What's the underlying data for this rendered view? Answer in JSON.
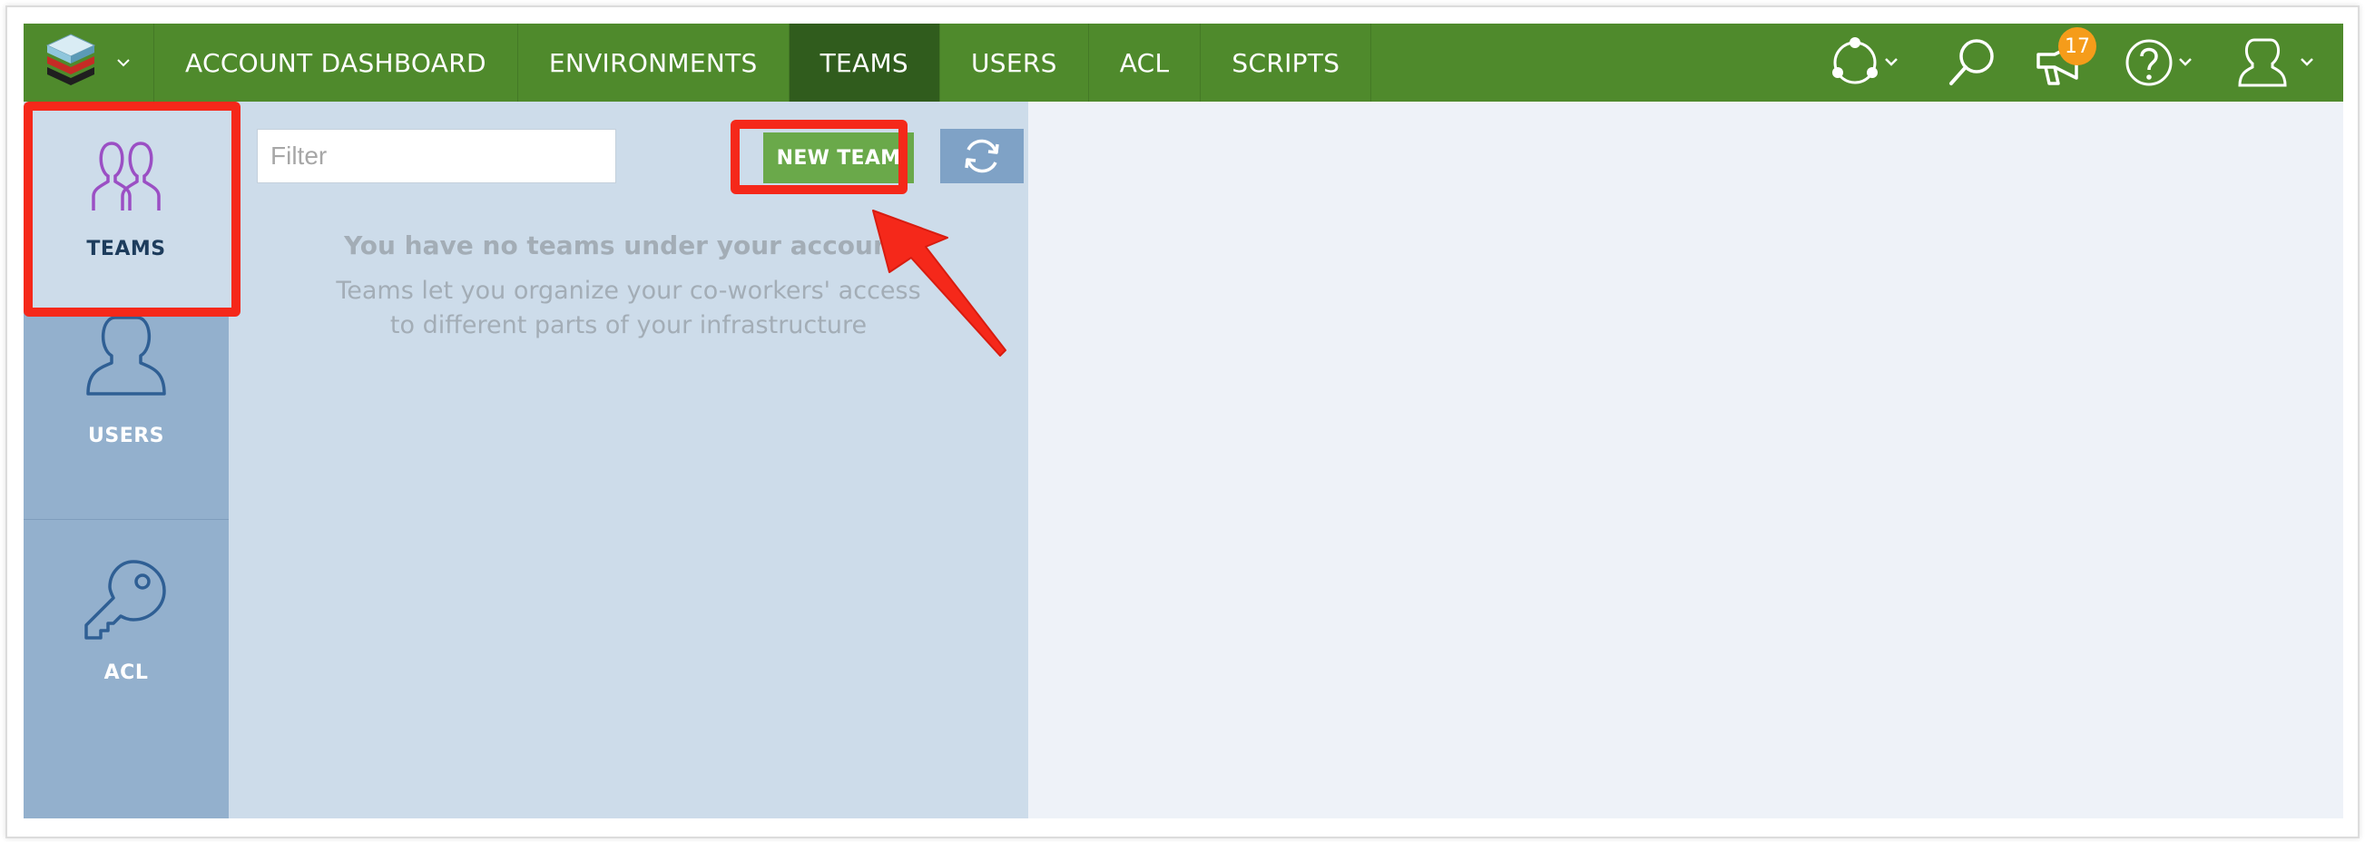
{
  "topbar": {
    "logo_icon": "stack-logo-icon",
    "nav": [
      {
        "label": "ACCOUNT DASHBOARD",
        "active": false
      },
      {
        "label": "ENVIRONMENTS",
        "active": false
      },
      {
        "label": "TEAMS",
        "active": true
      },
      {
        "label": "USERS",
        "active": false
      },
      {
        "label": "ACL",
        "active": false
      },
      {
        "label": "SCRIPTS",
        "active": false
      }
    ],
    "right_icons": [
      "network-icon",
      "search-icon",
      "announcements-icon",
      "help-icon",
      "user-icon"
    ],
    "notification_count": "17",
    "color": "#4f8a2c",
    "active_color": "#305c1d"
  },
  "sidebar": {
    "items": [
      {
        "label": "TEAMS",
        "icon": "teams-icon",
        "active": true
      },
      {
        "label": "USERS",
        "icon": "user-icon",
        "active": false
      },
      {
        "label": "ACL",
        "icon": "key-icon",
        "active": false
      }
    ]
  },
  "panel": {
    "filter_placeholder": "Filter",
    "filter_value": "",
    "new_team_label": "NEW TEAM",
    "refresh_icon": "refresh-icon",
    "empty_title": "You have no teams under your account.",
    "empty_desc_line1": "Teams let you organize your co-workers' access",
    "empty_desc_line2": "to different parts of your infrastructure"
  },
  "annotations": {
    "highlight_color": "#f5281a"
  }
}
